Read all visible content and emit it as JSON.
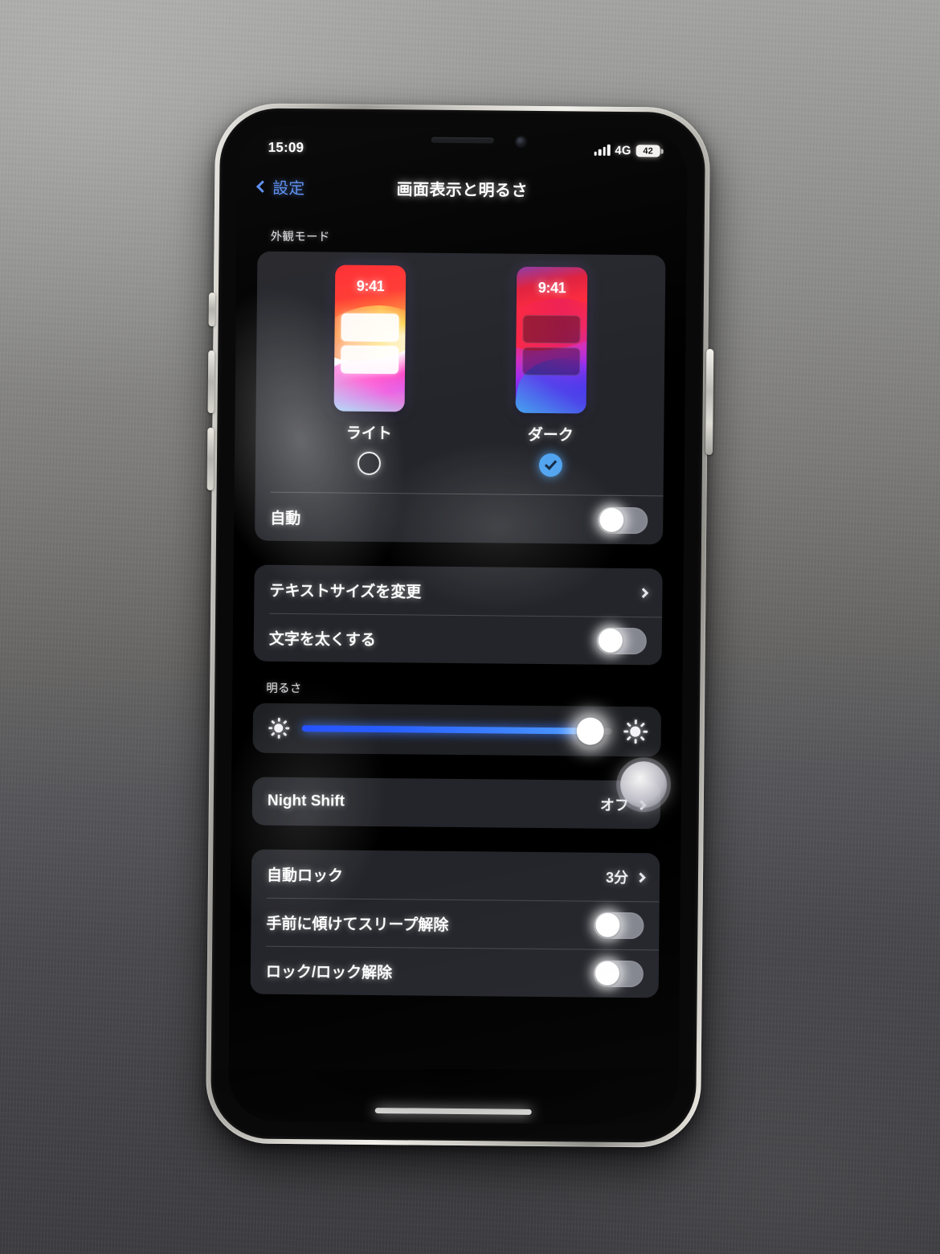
{
  "status_bar": {
    "time": "15:09",
    "signal_icon": "cellular-signal-icon",
    "network": "4G",
    "battery_level": "42"
  },
  "nav_bar": {
    "back_label": "設定",
    "back_icon": "chevron-left-icon",
    "title": "画面表示と明るさ"
  },
  "appearance": {
    "section_header": "外観モード",
    "options": [
      {
        "label": "ライト",
        "preview_clock": "9:41",
        "selected": false
      },
      {
        "label": "ダーク",
        "preview_clock": "9:41",
        "selected": true
      }
    ],
    "auto_row": {
      "label": "自動",
      "toggle_on": false
    }
  },
  "text_section": {
    "text_size_row": {
      "label": "テキストサイズを変更",
      "chevron": "chevron-right-icon"
    },
    "bold_text_row": {
      "label": "文字を太くする",
      "toggle_on": false
    }
  },
  "brightness": {
    "section_header": "明るさ",
    "low_icon": "sun-small-icon",
    "high_icon": "sun-large-icon",
    "value_percent": 93
  },
  "night_shift": {
    "label": "Night Shift",
    "value": "オフ",
    "chevron": "chevron-right-icon"
  },
  "lock_section": {
    "auto_lock_row": {
      "label": "自動ロック",
      "value": "3分",
      "chevron": "chevron-right-icon"
    },
    "raise_to_wake_row": {
      "label": "手前に傾けてスリープ解除",
      "toggle_on": false
    },
    "lock_unlock_row": {
      "label": "ロック/ロック解除",
      "toggle_on": false
    }
  },
  "colors": {
    "accent_blue": "#5a8df0",
    "selected_radio": "#4fa3f0",
    "slider_blue": "#2a63ff"
  }
}
